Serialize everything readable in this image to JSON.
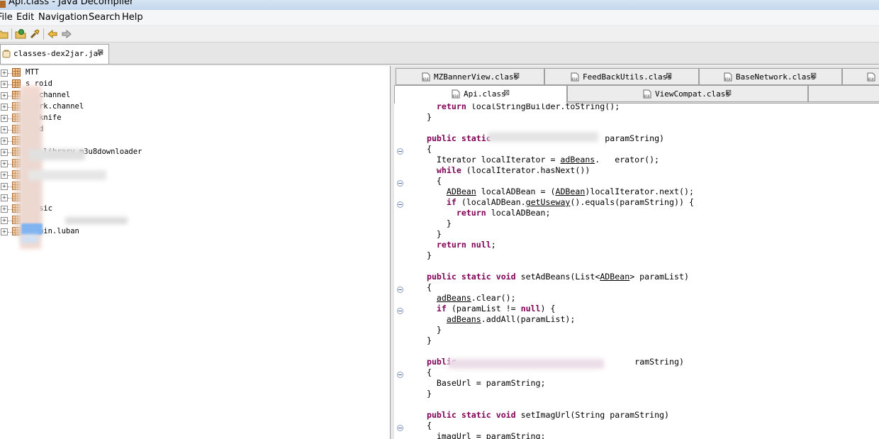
{
  "window": {
    "title": "Api.class - Java Decompiler"
  },
  "menu": [
    "File",
    "Edit",
    "Navigation",
    "Search",
    "Help"
  ],
  "toolbar": {
    "icons": [
      "open-file-icon",
      "open-type-icon",
      "search-flashlight-icon",
      "back-arrow-icon",
      "forward-arrow-icon"
    ]
  },
  "file_tab": {
    "label": "classes-dex2jar.jar",
    "close": "⊠"
  },
  "tree": {
    "items": [
      {
        "label": "MTT"
      },
      {
        "label": "s   roid"
      },
      {
        "label": "s   .channel"
      },
      {
        "label": "   twork.channel"
      },
      {
        "label": "   terknife"
      },
      {
        "label": "   jzvd"
      },
      {
        "label": "   m"
      },
      {
        "label": "   a   o.library.m3u8downloader"
      },
      {
        "label": ""
      },
      {
        "label": "   tp3"
      },
      {
        "label": ""
      },
      {
        "label": ""
      },
      {
        "label": "   missic"
      },
      {
        "label": ""
      },
      {
        "label": "   .zibin.luban"
      }
    ]
  },
  "class_tabs": {
    "row1": [
      "MZBannerView.class",
      "FeedBackUtils.class",
      "BaseNetwork.class"
    ],
    "row2": [
      "Api.class",
      "ViewCompat.class"
    ],
    "close": "⊠"
  },
  "code": {
    "lines": [
      "    return localStringBuilder.toString();",
      "  }",
      "",
      "  public static                       paramString)",
      "  {",
      "    Iterator localIterator = adBeans.   erator();",
      "    while (localIterator.hasNext())",
      "    {",
      "      ADBean localADBean = (ADBean)localIterator.next();",
      "      if (localADBean.getUseway().equals(paramString)) {",
      "        return localADBean;",
      "      }",
      "    }",
      "    return null;",
      "  }",
      "",
      "  public static void setAdBeans(List<ADBean> paramList)",
      "  {",
      "    adBeans.clear();",
      "    if (paramList != null) {",
      "      adBeans.addAll(paramList);",
      "    }",
      "  }",
      "",
      "  public                                    ramString)",
      "  {",
      "    BaseUrl = paramString;",
      "  }",
      "",
      "  public static void setImagUrl(String paramString)",
      "  {",
      "    imagUrl = paramString;"
    ]
  },
  "colors": {
    "keyword": "#7f0055",
    "selection": "#7fb4f0"
  }
}
